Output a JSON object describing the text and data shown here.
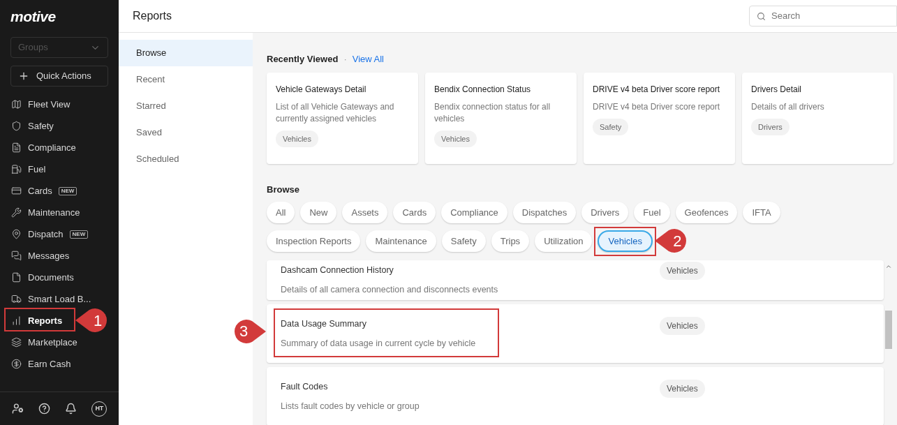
{
  "logo": "motive",
  "sidebar": {
    "groups_placeholder": "Groups",
    "quick_actions": "Quick Actions",
    "items": [
      {
        "label": "Fleet View",
        "selected": false
      },
      {
        "label": "Safety",
        "selected": false
      },
      {
        "label": "Compliance",
        "selected": false
      },
      {
        "label": "Fuel",
        "selected": false
      },
      {
        "label": "Cards",
        "badge": "NEW",
        "selected": false
      },
      {
        "label": "Maintenance",
        "selected": false
      },
      {
        "label": "Dispatch",
        "badge": "NEW",
        "selected": false
      },
      {
        "label": "Messages",
        "selected": false
      },
      {
        "label": "Documents",
        "selected": false
      },
      {
        "label": "Smart Load B...",
        "selected": false
      },
      {
        "label": "Reports",
        "selected": true,
        "callout": "1"
      },
      {
        "label": "Marketplace",
        "selected": false
      },
      {
        "label": "Earn Cash",
        "selected": false
      }
    ],
    "avatar": "HT"
  },
  "header": {
    "title": "Reports",
    "search_placeholder": "Search"
  },
  "nav": [
    {
      "label": "Browse",
      "selected": true
    },
    {
      "label": "Recent",
      "selected": false
    },
    {
      "label": "Starred",
      "selected": false
    },
    {
      "label": "Saved",
      "selected": false
    },
    {
      "label": "Scheduled",
      "selected": false
    }
  ],
  "recently_viewed": {
    "title": "Recently Viewed",
    "separator": "·",
    "link": "View All",
    "cards": [
      {
        "title": "Vehicle Gateways Detail",
        "description": "List of all Vehicle Gateways and currently assigned vehicles",
        "tag": "Vehicles"
      },
      {
        "title": "Bendix Connection Status",
        "description": "Bendix connection status for all vehicles",
        "tag": "Vehicles"
      },
      {
        "title": "DRIVE v4 beta Driver score report",
        "description": "DRIVE v4 beta Driver score report",
        "tag": "Safety"
      },
      {
        "title": "Drivers Detail",
        "description": "Details of all drivers",
        "tag": "Drivers"
      }
    ]
  },
  "browse": {
    "title": "Browse",
    "chips": [
      {
        "label": "All",
        "selected": false
      },
      {
        "label": "New",
        "selected": false
      },
      {
        "label": "Assets",
        "selected": false
      },
      {
        "label": "Cards",
        "selected": false
      },
      {
        "label": "Compliance",
        "selected": false
      },
      {
        "label": "Dispatches",
        "selected": false
      },
      {
        "label": "Drivers",
        "selected": false
      },
      {
        "label": "Fuel",
        "selected": false
      },
      {
        "label": "Geofences",
        "selected": false
      },
      {
        "label": "IFTA",
        "selected": false
      },
      {
        "label": "Inspection Reports",
        "selected": false
      },
      {
        "label": "Maintenance",
        "selected": false
      },
      {
        "label": "Safety",
        "selected": false
      },
      {
        "label": "Trips",
        "selected": false
      },
      {
        "label": "Utilization",
        "selected": false
      },
      {
        "label": "Vehicles",
        "selected": true,
        "callout": "2"
      }
    ]
  },
  "reports": [
    {
      "title": "Dashcam Connection History",
      "description": "Details of all camera connection and disconnects events",
      "tag": "Vehicles"
    },
    {
      "title": "Data Usage Summary",
      "description": "Summary of data usage in current cycle by vehicle",
      "tag": "Vehicles",
      "callout": "3"
    },
    {
      "title": "Fault Codes",
      "description": "Lists fault codes by vehicle or group",
      "tag": "Vehicles"
    }
  ]
}
